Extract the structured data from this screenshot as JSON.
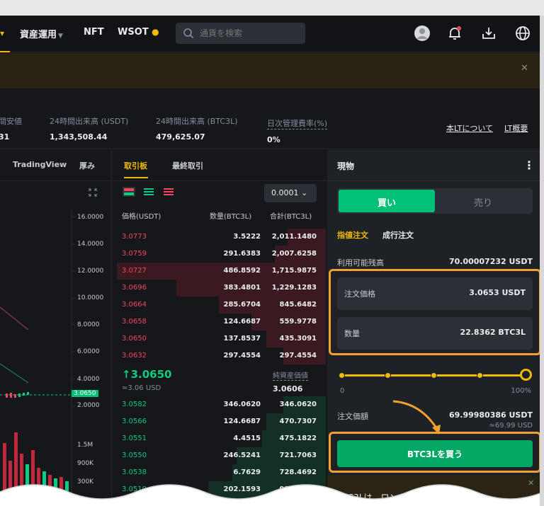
{
  "nav": {
    "items": [
      {
        "label": "資産運用",
        "has_dropdown": true
      },
      {
        "label": "NFT"
      },
      {
        "label": "WSOT"
      }
    ],
    "search_placeholder": "通貨を検索",
    "icons": [
      "avatar-icon",
      "bell-icon",
      "download-icon",
      "globe-icon"
    ]
  },
  "stats": {
    "items": [
      {
        "label": "間安値",
        "value": "31"
      },
      {
        "label": "24時間出来高 (USDT)",
        "value": "1,343,508.44"
      },
      {
        "label": "24時間出来高 (BTC3L)",
        "value": "479,625.07"
      },
      {
        "label": "日次管理費率(%)",
        "value": "0%"
      }
    ],
    "links": [
      "本LTについて",
      "LT概要"
    ]
  },
  "chart": {
    "tabs": [
      "TradingView",
      "厚み"
    ],
    "y_labels": [
      "16.0000",
      "14.0000",
      "12.0000",
      "10.0000",
      "8.0000",
      "6.0000",
      "4.0000",
      "2.0000"
    ],
    "current_price": "3.0650",
    "vol_labels": [
      "1.5M",
      "900K",
      "300K"
    ],
    "colors": {
      "up": "#0ecb81",
      "down": "#f6465d",
      "bar_down": "#c0283d"
    }
  },
  "book": {
    "tabs": [
      "取引板",
      "最終取引"
    ],
    "precision": "0.0001",
    "headers": [
      "価格(USDT)",
      "数量(BTC3L)",
      "合計(BTC3L)"
    ],
    "asks": [
      {
        "price": "3.0773",
        "amount": "3.5222",
        "total": "2,011.1480",
        "depth": 0.18
      },
      {
        "price": "3.0759",
        "amount": "291.6383",
        "total": "2,007.6258",
        "depth": 0.24
      },
      {
        "price": "3.0727",
        "amount": "486.8592",
        "total": "1,715.9875",
        "depth": 0.98
      },
      {
        "price": "3.0696",
        "amount": "383.4801",
        "total": "1,229.1283",
        "depth": 0.7
      },
      {
        "price": "3.0664",
        "amount": "285.6704",
        "total": "845.6482",
        "depth": 0.5
      },
      {
        "price": "3.0658",
        "amount": "124.6687",
        "total": "559.9778",
        "depth": 0.35
      },
      {
        "price": "3.0650",
        "amount": "137.8537",
        "total": "435.3091",
        "depth": 0.28
      },
      {
        "price": "3.0632",
        "amount": "297.4554",
        "total": "297.4554",
        "depth": 0.2
      }
    ],
    "last_price": "↑3.0650",
    "last_price_usd": "≈3.06 USD",
    "nav_label": "純資産価値",
    "nav_value": "3.0606",
    "bids": [
      {
        "price": "3.0582",
        "amount": "346.0620",
        "total": "346.0620",
        "depth": 0.2
      },
      {
        "price": "3.0566",
        "amount": "124.6687",
        "total": "470.7307",
        "depth": 0.28
      },
      {
        "price": "3.0551",
        "amount": "4.4515",
        "total": "475.1822",
        "depth": 0.3
      },
      {
        "price": "3.0550",
        "amount": "246.5241",
        "total": "721.7063",
        "depth": 0.42
      },
      {
        "price": "3.0538",
        "amount": "6.7629",
        "total": "728.4692",
        "depth": 0.44
      },
      {
        "price": "3.0519",
        "amount": "202.1593",
        "total": "930.6285",
        "depth": 0.55
      }
    ]
  },
  "trade": {
    "title": "現物",
    "buy_label": "買い",
    "sell_label": "売り",
    "order_types": [
      "指値注文",
      "成行注文"
    ],
    "available_label": "利用可能残高",
    "available_value": "70.00007232 USDT",
    "price_label": "注文価格",
    "price_value": "3.0653 USDT",
    "qty_label": "数量",
    "qty_value": "22.8362 BTC3L",
    "slider_min": "0",
    "slider_max": "100%",
    "slider_percent": 100,
    "order_value_label": "注文価額",
    "order_value": "69.99980386 USDT",
    "order_value_usd": "≈69.99 USD",
    "buy_button": "BTC3Lを買う",
    "notice": "BTC3Lは、ロングしているレ"
  },
  "colors": {
    "accent": "#f0b90b",
    "highlight": "#f3a12e",
    "buy": "#02c076",
    "sell": "#f6465d"
  }
}
